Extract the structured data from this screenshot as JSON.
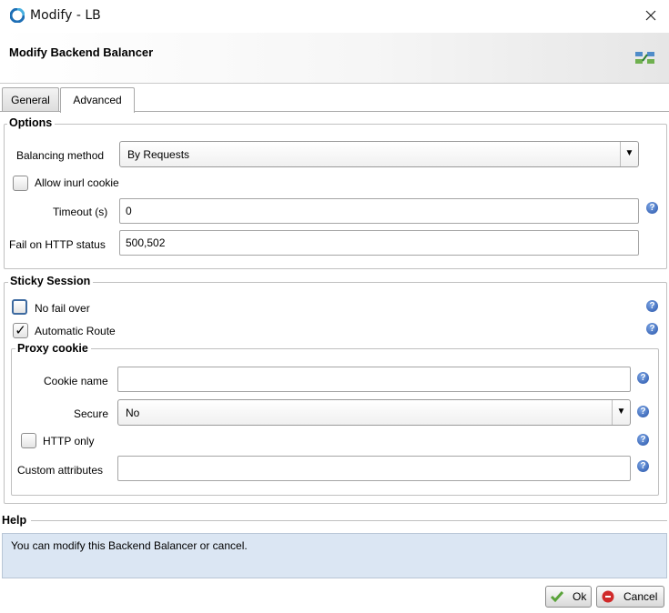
{
  "window": {
    "title": "Modify - LB",
    "close_symbol": "✕"
  },
  "header": {
    "title": "Modify Backend Balancer",
    "icon": "balancer-icon"
  },
  "tabs": [
    {
      "label": "General",
      "selected": false
    },
    {
      "label": "Advanced",
      "selected": true
    }
  ],
  "options": {
    "legend": "Options",
    "balancing_method_label": "Balancing method",
    "balancing_method_value": "By Requests",
    "allow_inurl_cookie_label": "Allow inurl cookie",
    "allow_inurl_cookie_checked": false,
    "timeout_label": "Timeout (s)",
    "timeout_value": "0",
    "fail_status_label": "Fail on HTTP status",
    "fail_status_value": "500,502"
  },
  "sticky": {
    "legend": "Sticky Session",
    "no_fail_over_label": "No fail over",
    "no_fail_over_checked": false,
    "automatic_route_label": "Automatic Route",
    "automatic_route_checked": true
  },
  "proxy_cookie": {
    "legend": "Proxy cookie",
    "cookie_name_label": "Cookie name",
    "cookie_name_value": "",
    "secure_label": "Secure",
    "secure_value": "No",
    "http_only_label": "HTTP only",
    "http_only_checked": false,
    "custom_attributes_label": "Custom attributes",
    "custom_attributes_value": ""
  },
  "help": {
    "legend": "Help",
    "text": "You can modify this Backend Balancer or cancel."
  },
  "buttons": {
    "ok_label": "Ok",
    "cancel_label": "Cancel"
  },
  "glyphs": {
    "help": "?",
    "check": "✓",
    "dropdown_arrow": "▼"
  }
}
